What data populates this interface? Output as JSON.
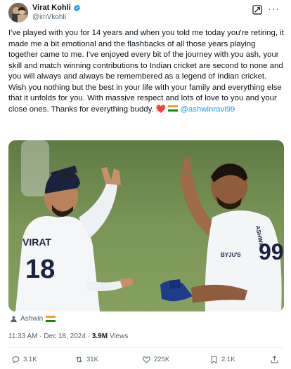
{
  "author": {
    "name": "Virat Kohli",
    "handle": "@imVkohli"
  },
  "tweet": {
    "text": "I've played with you for 14 years and when you told me today you're retiring, it made me a bit emotional and the flashbacks of all those years playing together came to me. I've enjoyed every bit of the journey with you ash, your skill and match winning contributions to Indian cricket are second to none and you will always and always be remembered as a legend of Indian cricket. Wish you nothing but the best in your life with your family and everything else that it unfolds for you. With massive respect and lots of love to you and your close ones. Thanks for everything buddy.",
    "mention": "@ashwinravi99"
  },
  "photo": {
    "shirt_left": "VIRAT",
    "number_left": "18",
    "sponsor_right": "BYJU'S",
    "number_right": "99",
    "name_right": "ASHWIN"
  },
  "tagged": "Ashwin",
  "meta": {
    "time": "11:33 AM",
    "sep1": "·",
    "date": "Dec 18, 2024",
    "sep2": "·",
    "views": "3.9M",
    "views_label": "Views"
  },
  "actions": {
    "replies": "3.1K",
    "reposts": "31K",
    "likes": "225K",
    "bookmarks": "2.1K"
  },
  "colors": {
    "accent": "#1d9bf0",
    "heart": "#e0245e",
    "text": "#0f1419",
    "muted": "#536471"
  },
  "icons": [
    "verified-badge-icon",
    "grok-icon",
    "more-icon",
    "heart-emoji-icon",
    "india-flag-icon",
    "user-icon",
    "reply-icon",
    "repost-icon",
    "like-icon",
    "views-icon",
    "bookmark-icon",
    "share-icon"
  ]
}
